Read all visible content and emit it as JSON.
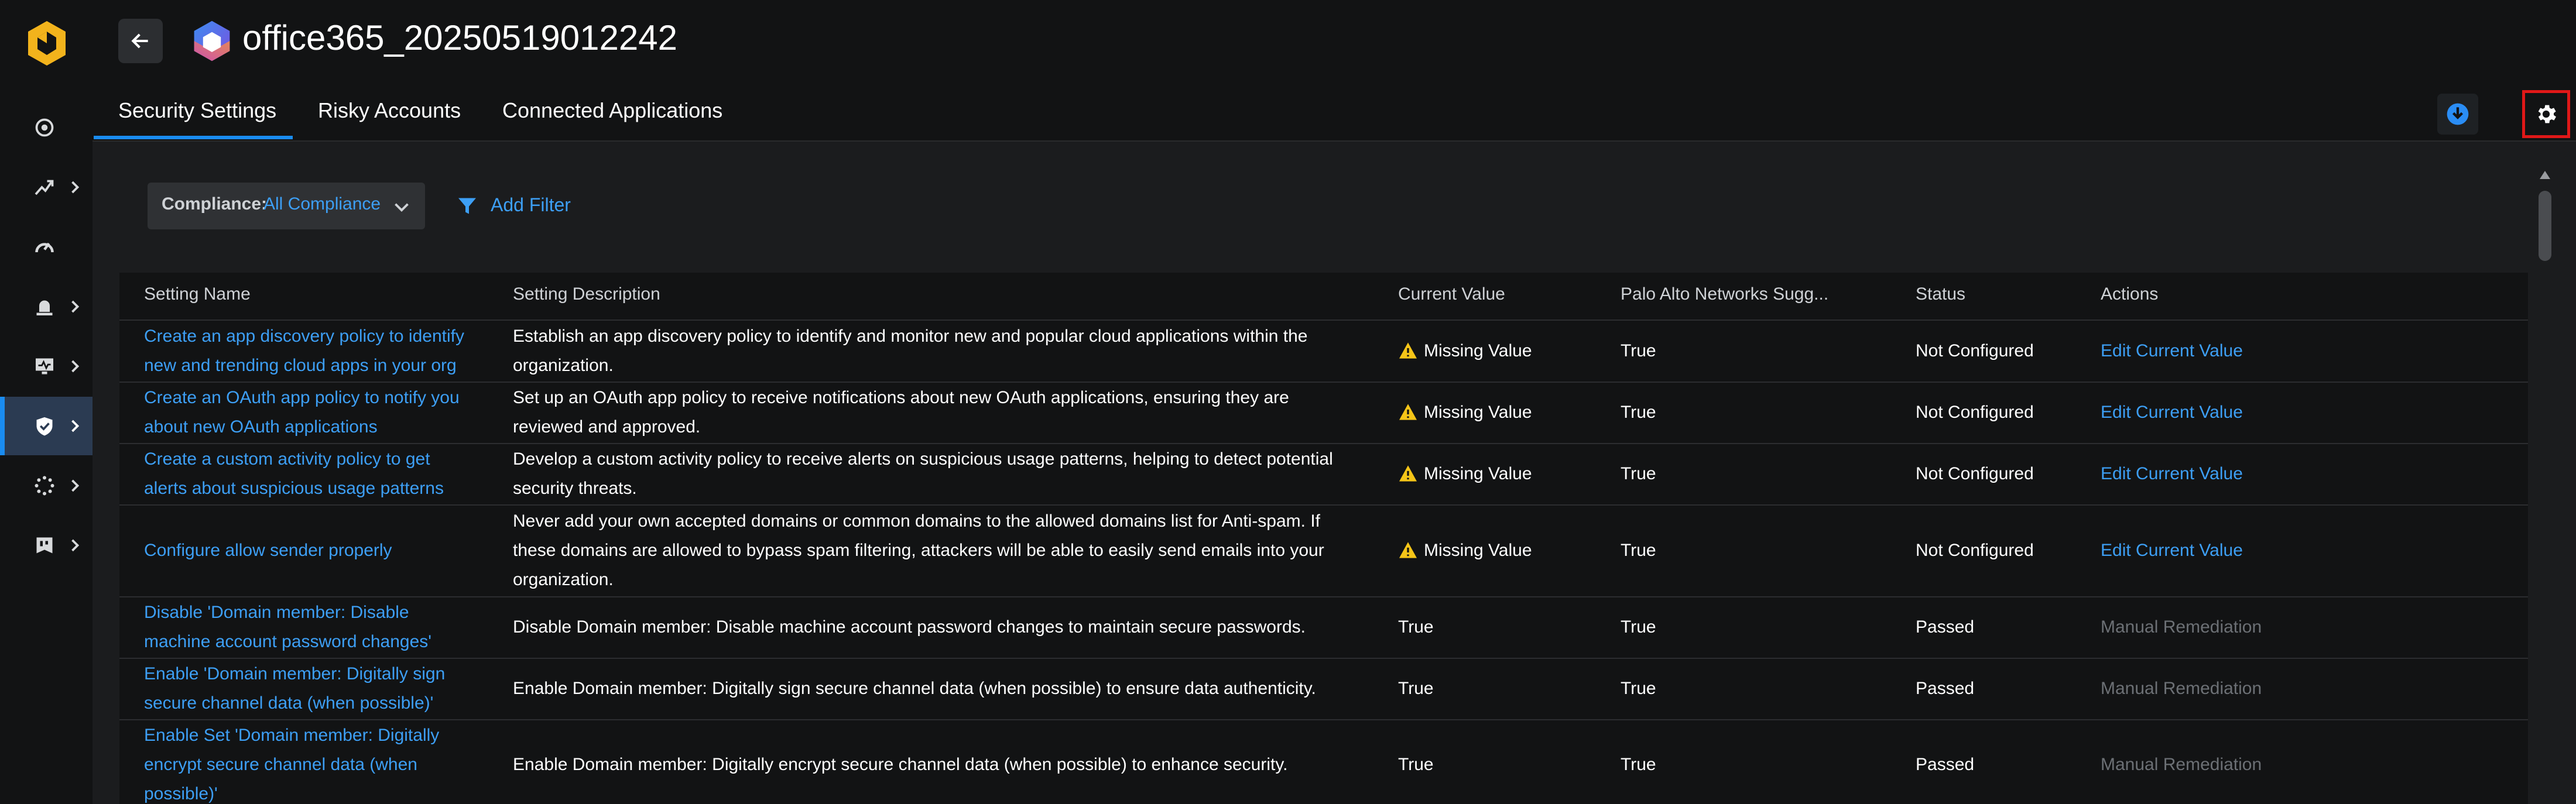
{
  "app": {
    "title": "office365_20250519012242"
  },
  "tabs": [
    {
      "label": "Security Settings"
    },
    {
      "label": "Risky Accounts"
    },
    {
      "label": "Connected Applications"
    }
  ],
  "filter": {
    "label": "Compliance:",
    "value": "All Compliance",
    "add_label": "Add Filter"
  },
  "table": {
    "columns": [
      "Setting Name",
      "Setting Description",
      "Current Value",
      "Palo Alto Networks Sugg...",
      "Status",
      "Actions"
    ],
    "rows": [
      {
        "name": [
          "Create an app discovery policy to identify",
          "new and trending cloud apps in your org"
        ],
        "desc": [
          "Establish an app discovery policy to identify and monitor new and popular cloud applications within the",
          "organization."
        ],
        "current": "Missing Value",
        "warn": true,
        "suggested": "True",
        "status": "Not Configured",
        "action": "Edit Current Value",
        "action_enabled": true
      },
      {
        "name": [
          "Create an OAuth app policy to notify you",
          "about new OAuth applications"
        ],
        "desc": [
          "Set up an OAuth app policy to receive notifications about new OAuth applications, ensuring they are",
          "reviewed and approved."
        ],
        "current": "Missing Value",
        "warn": true,
        "suggested": "True",
        "status": "Not Configured",
        "action": "Edit Current Value",
        "action_enabled": true
      },
      {
        "name": [
          "Create a custom activity policy to get",
          "alerts about suspicious usage patterns"
        ],
        "desc": [
          "Develop a custom activity policy to receive alerts on suspicious usage patterns, helping to detect potential",
          "security threats."
        ],
        "current": "Missing Value",
        "warn": true,
        "suggested": "True",
        "status": "Not Configured",
        "action": "Edit Current Value",
        "action_enabled": true
      },
      {
        "name": [
          "Configure allow sender properly"
        ],
        "desc": [
          "Never add your own accepted domains or common domains to the allowed domains list for Anti-spam. If",
          "these domains are allowed to bypass spam filtering, attackers will be able to easily send emails into your",
          "organization."
        ],
        "current": "Missing Value",
        "warn": true,
        "suggested": "True",
        "status": "Not Configured",
        "action": "Edit Current Value",
        "action_enabled": true
      },
      {
        "name": [
          "Disable 'Domain member: Disable",
          "machine account password changes'"
        ],
        "desc": [
          "Disable Domain member: Disable machine account password changes to maintain secure passwords."
        ],
        "current": "True",
        "warn": false,
        "suggested": "True",
        "status": "Passed",
        "action": "Manual Remediation",
        "action_enabled": false
      },
      {
        "name": [
          "Enable 'Domain member: Digitally sign",
          "secure channel data (when possible)'"
        ],
        "desc": [
          "Enable Domain member: Digitally sign secure channel data (when possible) to ensure data authenticity."
        ],
        "current": "True",
        "warn": false,
        "suggested": "True",
        "status": "Passed",
        "action": "Manual Remediation",
        "action_enabled": false
      },
      {
        "name": [
          "Enable Set 'Domain member: Digitally",
          "encrypt secure channel data (when",
          "possible)'"
        ],
        "desc": [
          "Enable Domain member: Digitally encrypt secure channel data (when possible) to enhance security."
        ],
        "current": "True",
        "warn": false,
        "suggested": "True",
        "status": "Passed",
        "action": "Manual Remediation",
        "action_enabled": false
      }
    ]
  },
  "colors": {
    "accent": "#1a8cf0",
    "link": "#3d9ff5",
    "warning": "#f5c518",
    "highlight_border": "#e01818"
  },
  "icons": [
    "back-arrow-icon",
    "office365-icon",
    "download-icon",
    "gear-icon",
    "filter-icon",
    "warning-icon"
  ]
}
